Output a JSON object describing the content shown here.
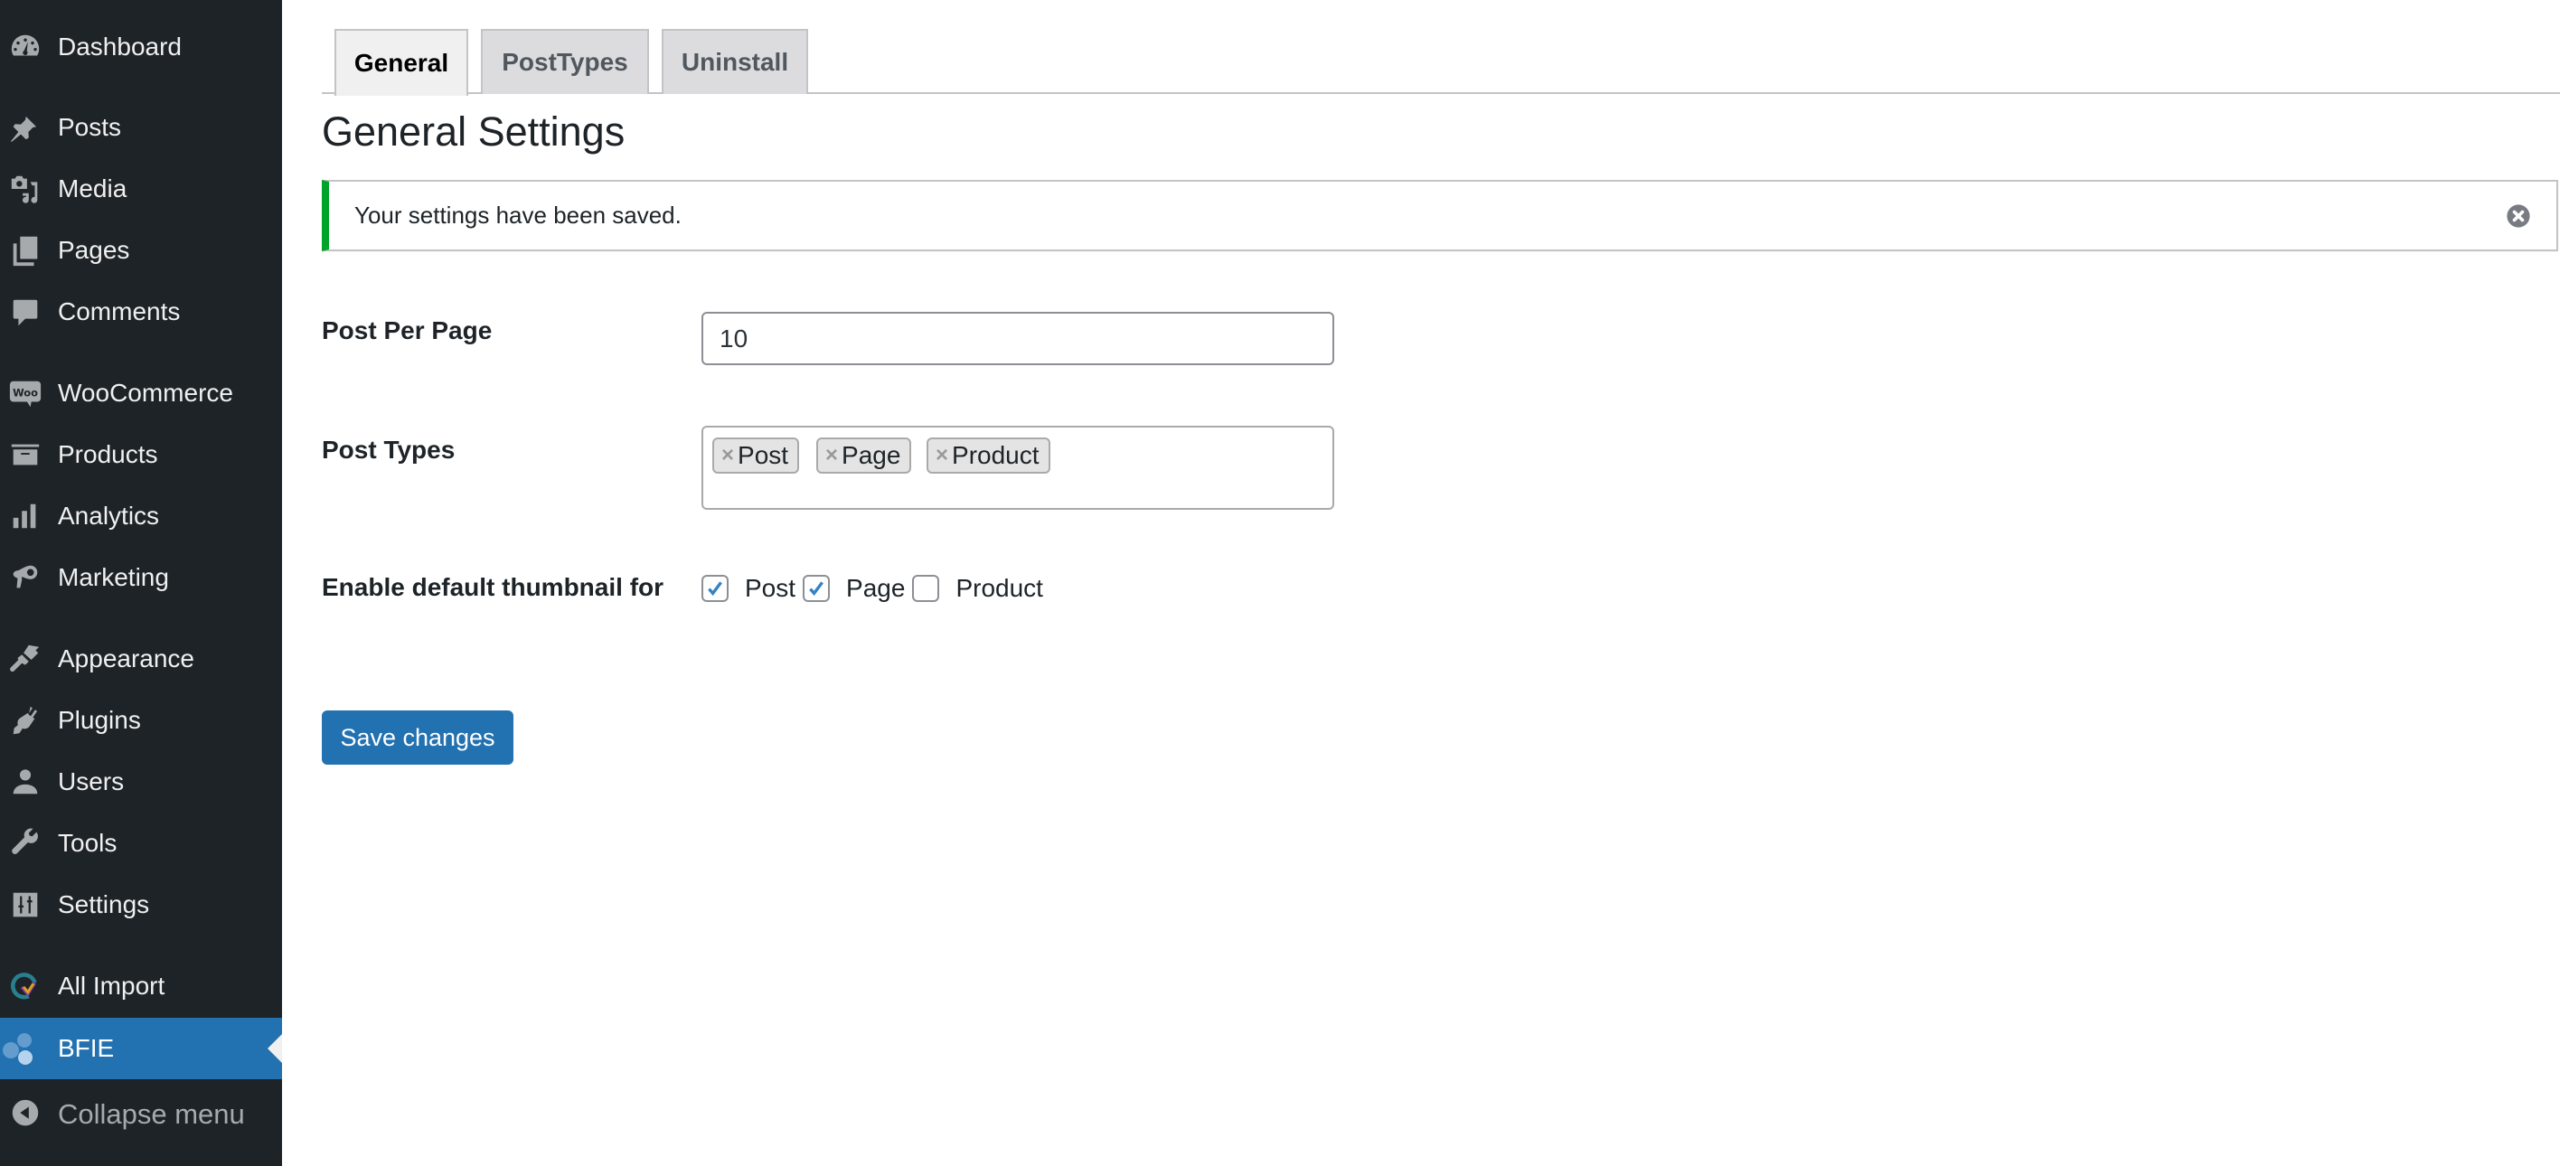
{
  "sidebar": {
    "items": [
      {
        "label": "Dashboard",
        "icon": "dashboard-icon"
      },
      {
        "label": "Posts",
        "icon": "pushpin-icon"
      },
      {
        "label": "Media",
        "icon": "media-icon"
      },
      {
        "label": "Pages",
        "icon": "pages-icon"
      },
      {
        "label": "Comments",
        "icon": "comment-icon"
      },
      {
        "label": "WooCommerce",
        "icon": "woocommerce-icon"
      },
      {
        "label": "Products",
        "icon": "archive-box-icon"
      },
      {
        "label": "Analytics",
        "icon": "bar-chart-icon"
      },
      {
        "label": "Marketing",
        "icon": "megaphone-icon"
      },
      {
        "label": "Appearance",
        "icon": "paintbrush-icon"
      },
      {
        "label": "Plugins",
        "icon": "plug-icon"
      },
      {
        "label": "Users",
        "icon": "user-icon"
      },
      {
        "label": "Tools",
        "icon": "wrench-icon"
      },
      {
        "label": "Settings",
        "icon": "sliders-icon"
      },
      {
        "label": "All Import",
        "icon": "all-import-icon"
      },
      {
        "label": "BFIE",
        "icon": "bubbles-icon",
        "active": true
      }
    ],
    "collapse_label": "Collapse menu",
    "active_color": "#2271b1",
    "background_color": "#1d2327"
  },
  "tabs": [
    {
      "label": "General",
      "active": true
    },
    {
      "label": "PostTypes",
      "active": false
    },
    {
      "label": "Uninstall",
      "active": false
    }
  ],
  "page_title": "General Settings",
  "notice": {
    "message": "Your settings have been saved.",
    "type": "success",
    "accent_color": "#00a32a"
  },
  "form": {
    "post_per_page": {
      "label": "Post Per Page",
      "value": "10"
    },
    "post_types": {
      "label": "Post Types",
      "selected": [
        "Post",
        "Page",
        "Product"
      ],
      "remove_glyph": "×"
    },
    "thumbnail": {
      "label": "Enable default thumbnail for",
      "options": [
        {
          "label": "Post",
          "checked": true
        },
        {
          "label": "Page",
          "checked": true
        },
        {
          "label": "Product",
          "checked": false
        }
      ]
    },
    "save_label": "Save changes"
  }
}
